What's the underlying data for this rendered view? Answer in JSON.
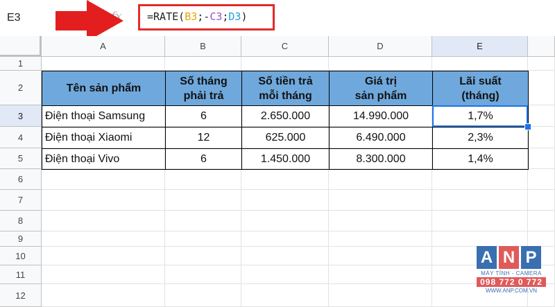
{
  "formula_bar": {
    "name_box": "E3",
    "fx_label": "fx",
    "formula_prefix": "=RATE(",
    "ref_b": "B3",
    "sep1": ";-",
    "ref_c": "C3",
    "sep2": ";",
    "ref_d": "D3",
    "formula_suffix": ")"
  },
  "columns": [
    "A",
    "B",
    "C",
    "D",
    "E"
  ],
  "rows": [
    "1",
    "2",
    "3",
    "4",
    "5",
    "6",
    "7",
    "8",
    "9",
    "10",
    "11",
    "12"
  ],
  "table": {
    "headers": [
      [
        "Tên sản phẩm"
      ],
      [
        "Số tháng",
        "phải trả"
      ],
      [
        "Số tiền trả",
        "mỗi tháng"
      ],
      [
        "Giá trị",
        "sản phẩm"
      ],
      [
        "Lãi suất",
        "(tháng)"
      ]
    ],
    "data": [
      [
        "Điện thoại Samsung",
        "6",
        "2.650.000",
        "14.990.000",
        "1,7%"
      ],
      [
        "Điện thoại Xiaomi",
        "12",
        "625.000",
        "6.490.000",
        "2,3%"
      ],
      [
        "Điện thoại Vivo",
        "6",
        "1.450.000",
        "8.300.000",
        "1,4%"
      ]
    ]
  },
  "selection": {
    "cell": "E3",
    "color": "#1a73e8"
  },
  "colors": {
    "header_fill": "#6fa8dc",
    "arrow": "#e31e1e",
    "formula_border": "#e32b2b"
  },
  "watermark": {
    "letters": [
      "A",
      "N",
      "P"
    ],
    "letter_colors": [
      "#3a6fb0",
      "#e05a5a",
      "#3a6fb0"
    ],
    "tagline": "MÁY TÍNH - CAMERA",
    "phone": "098 772 0 772",
    "url": "WWW.ANP.COM.VN"
  },
  "icons": {
    "arrow": "right-arrow-icon"
  }
}
